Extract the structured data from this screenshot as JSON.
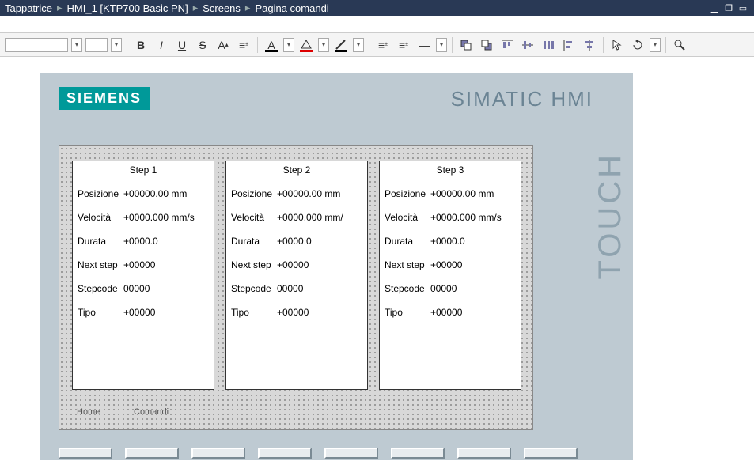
{
  "breadcrumb": [
    "Tappatrice",
    "HMI_1 [KTP700 Basic PN]",
    "Screens",
    "Pagina comandi"
  ],
  "branding": {
    "logo": "SIEMENS",
    "product": "SIMATIC HMI",
    "side": "TOUCH"
  },
  "toolbar": {
    "font_name": "",
    "font_size": ""
  },
  "steps": [
    {
      "title": "Step 1",
      "fields": [
        {
          "label": "Posizione",
          "value": "+00000.00 mm"
        },
        {
          "label": "Velocità",
          "value": "+0000.000 mm/s"
        },
        {
          "label": "Durata",
          "value": "+0000.0"
        },
        {
          "label": "Next step",
          "value": "+00000"
        },
        {
          "label": "Stepcode",
          "value": "00000"
        },
        {
          "label": "Tipo",
          "value": "+00000"
        }
      ]
    },
    {
      "title": "Step 2",
      "fields": [
        {
          "label": "Posizione",
          "value": "+00000.00 mm"
        },
        {
          "label": "Velocità",
          "value": "+0000.000 mm/"
        },
        {
          "label": "Durata",
          "value": "+0000.0"
        },
        {
          "label": "Next step",
          "value": "+00000"
        },
        {
          "label": "Stepcode",
          "value": "00000"
        },
        {
          "label": "Tipo",
          "value": "+00000"
        }
      ]
    },
    {
      "title": "Step 3",
      "fields": [
        {
          "label": "Posizione",
          "value": "+00000.00 mm"
        },
        {
          "label": "Velocità",
          "value": "+0000.000 mm/s"
        },
        {
          "label": "Durata",
          "value": "+0000.0"
        },
        {
          "label": "Next step",
          "value": "+00000"
        },
        {
          "label": "Stepcode",
          "value": "00000"
        },
        {
          "label": "Tipo",
          "value": "+00000"
        }
      ]
    }
  ],
  "nav": {
    "home": "Home",
    "comandi": "Comandi"
  }
}
